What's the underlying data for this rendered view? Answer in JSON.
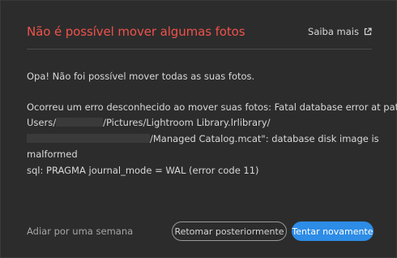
{
  "dialog": {
    "title": "Não é possível mover algumas fotos",
    "learn_more_label": "Saiba mais",
    "learn_more_icon": "external-link-icon",
    "summary": "Opa! Não foi possível mover todas as suas fotos.",
    "details": {
      "line1": "Ocorreu um erro desconhecido ao mover suas fotos: Fatal database error at path \"/",
      "line2_prefix": "Users/",
      "line2_suffix": "/Pictures/Lightroom Library.lrlibrary/",
      "line3_suffix": "/Managed Catalog.mcat\": database disk image is",
      "line4": "malformed",
      "line5": "sql: PRAGMA journal_mode = WAL (error code 11)"
    },
    "postpone_label": "Adiar por uma semana",
    "resume_later_label": "Retomar posteriormente",
    "retry_label": "Tentar novamente"
  },
  "colors": {
    "title": "#f0524b",
    "primary_button": "#2d8ce6",
    "background": "#2c2c2c"
  }
}
